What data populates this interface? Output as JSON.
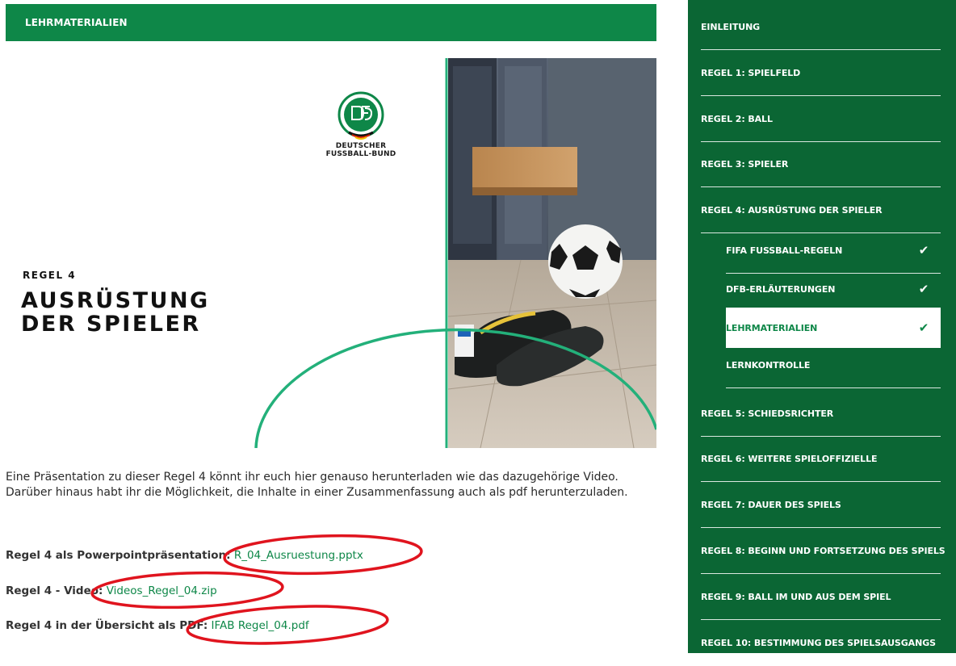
{
  "header": {
    "title": "LEHRMATERIALIEN"
  },
  "hero": {
    "logo_text_line1": "DEUTSCHER",
    "logo_text_line2": "FUSSBALL-BUND",
    "kicker": "REGEL 4",
    "title_line1": "AUSRÜSTUNG",
    "title_line2": "DER SPIELER"
  },
  "intro_text": "Eine Präsentation zu dieser Regel 4 könnt ihr euch hier genauso herunterladen wie das dazugehörige Video. Darüber hinaus habt ihr die Möglichkeit, die Inhalte in einer Zusammenfassung auch als pdf herunterzuladen.",
  "downloads": [
    {
      "label": "Regel 4 als Powerpointpräsentation:",
      "link": "R_04_Ausruestung.pptx"
    },
    {
      "label": "Regel 4 - Video:",
      "link": "Videos_Regel_04.zip"
    },
    {
      "label": "Regel 4 in der Übersicht als PDF:",
      "link": "IFAB Regel_04.pdf"
    }
  ],
  "sidebar": {
    "items": [
      {
        "label": "EINLEITUNG"
      },
      {
        "label": "REGEL 1: SPIELFELD"
      },
      {
        "label": "REGEL 2: BALL"
      },
      {
        "label": "REGEL 3: SPIELER"
      },
      {
        "label": "REGEL 4: AUSRÜSTUNG DER SPIELER"
      },
      {
        "label": "FIFA FUSSBALL-REGELN",
        "check": "✔"
      },
      {
        "label": "DFB-ERLÄUTERUNGEN",
        "check": "✔"
      },
      {
        "label": "LEHRMATERIALIEN",
        "check": "✔"
      },
      {
        "label": "LERNKONTROLLE"
      },
      {
        "label": "REGEL 5: SCHIEDSRICHTER"
      },
      {
        "label": "REGEL 6: WEITERE SPIELOFFIZIELLE"
      },
      {
        "label": "REGEL 7: DAUER DES SPIELS"
      },
      {
        "label": "REGEL 8: BEGINN UND FORTSETZUNG DES SPIELS"
      },
      {
        "label": "REGEL 9: BALL IM UND AUS DEM SPIEL"
      },
      {
        "label": "REGEL 10: BESTIMMUNG DES SPIELSAUSGANGS"
      }
    ]
  },
  "colors": {
    "accent": "#0e8748",
    "sidebar_bg": "#0b6634",
    "annotation_ring": "#e0141e"
  }
}
